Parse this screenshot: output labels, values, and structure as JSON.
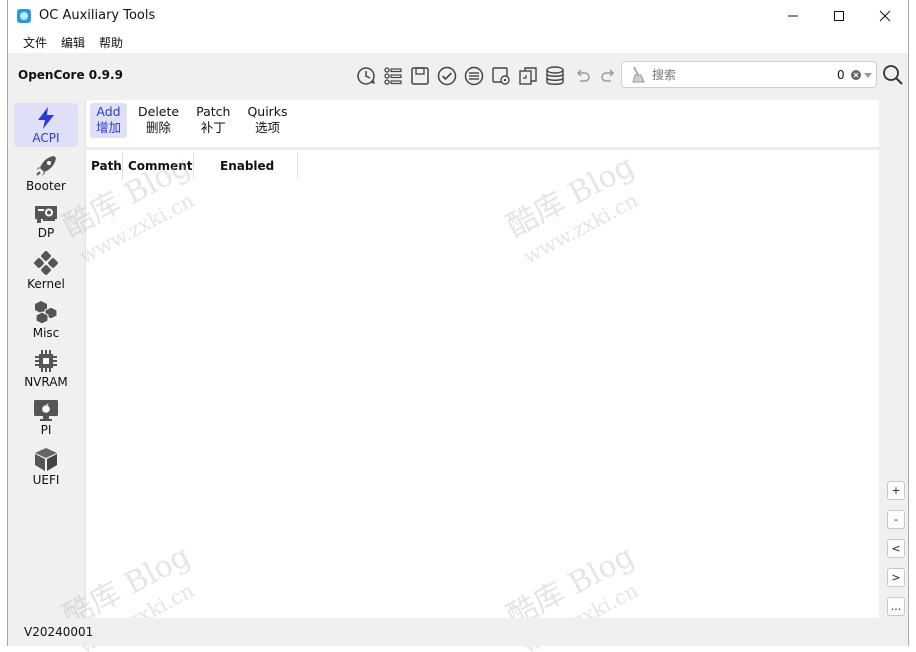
{
  "window": {
    "title": "OC Auxiliary Tools"
  },
  "menu": [
    "文件",
    "编辑",
    "帮助"
  ],
  "toolbar": {
    "version": "OpenCore 0.9.9",
    "icons": [
      "history-icon",
      "list-icon",
      "save-icon",
      "check-icon",
      "list-circle-icon",
      "config-icon",
      "copy-icon",
      "database-icon",
      "undo-icon",
      "redo-icon"
    ],
    "search": {
      "placeholder": "搜索",
      "value": "",
      "count": "0"
    }
  },
  "sidebar": [
    {
      "label": "ACPI",
      "icon": "bolt-icon",
      "active": true
    },
    {
      "label": "Booter",
      "icon": "rocket-icon"
    },
    {
      "label": "DP",
      "icon": "gpu-card-icon"
    },
    {
      "label": "Kernel",
      "icon": "kernel-icon"
    },
    {
      "label": "Misc",
      "icon": "misc-icon"
    },
    {
      "label": "NVRAM",
      "icon": "chip-icon"
    },
    {
      "label": "PI",
      "icon": "apple-monitor-icon"
    },
    {
      "label": "UEFI",
      "icon": "cube-icon"
    }
  ],
  "tabs": [
    {
      "en": "Add",
      "zh": "增加",
      "active": true
    },
    {
      "en": "Delete",
      "zh": "删除"
    },
    {
      "en": "Patch",
      "zh": "补丁"
    },
    {
      "en": "Quirks",
      "zh": "选项"
    }
  ],
  "table": {
    "columns": [
      "Path",
      "Comment",
      "Enabled"
    ],
    "rows": []
  },
  "side_buttons": [
    "+",
    "-",
    "<",
    ">",
    "..."
  ],
  "status": {
    "build": "V20240001"
  },
  "watermark": {
    "brand": "酷库 Blog",
    "url": "www.zxki.cn"
  },
  "colors": {
    "accent": "#2a3bd6",
    "active_bg": "#dfe0f7"
  }
}
